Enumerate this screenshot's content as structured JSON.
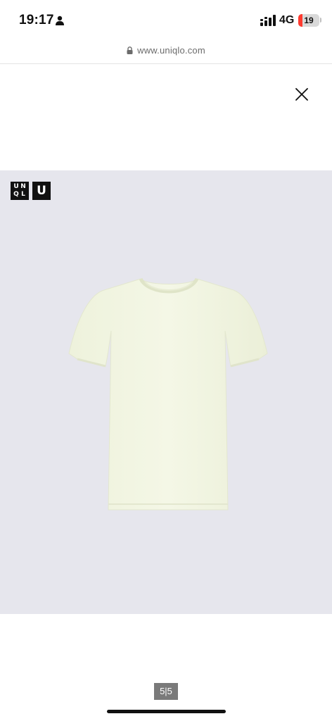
{
  "status_bar": {
    "time": "19:17",
    "network": "4G",
    "battery_level": "19",
    "battery_fraction": 0.19,
    "icons": [
      "person-icon",
      "signal-icon"
    ]
  },
  "browser": {
    "url": "www.uniqlo.com",
    "icons": [
      "lock-icon"
    ]
  },
  "viewer": {
    "close_icon": "close-icon",
    "logo": {
      "uniqlo_letters": [
        "UNI",
        "QLO"
      ],
      "u_letter": "U"
    },
    "product_image": "white crew neck short sleeve t-shirt",
    "pagination": "5|5",
    "colors": {
      "image_background": "#e6e6ed",
      "tshirt": "#f2f5e2",
      "battery_fill": "#ff3b30",
      "pagination_bg": "#7a7a7a"
    }
  }
}
